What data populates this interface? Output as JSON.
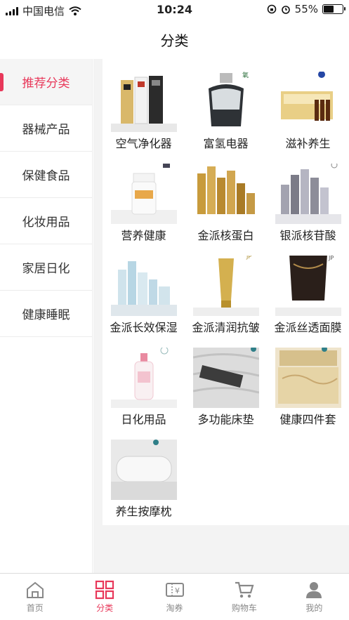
{
  "status": {
    "carrier": "中国电信",
    "time": "10:24",
    "battery": "55%"
  },
  "header": {
    "title": "分类"
  },
  "sidebar": {
    "items": [
      {
        "label": "推荐分类",
        "active": true
      },
      {
        "label": "器械产品"
      },
      {
        "label": "保健食品"
      },
      {
        "label": "化妆用品"
      },
      {
        "label": "家居日化"
      },
      {
        "label": "健康睡眠"
      }
    ]
  },
  "products": [
    {
      "label": "空气净化器",
      "icon": "air-purifier"
    },
    {
      "label": "富氢电器",
      "icon": "hydrogen-appliance"
    },
    {
      "label": "滋补养生",
      "icon": "tonic-box"
    },
    {
      "label": "营养健康",
      "icon": "nutrition-bottle"
    },
    {
      "label": "金派核蛋白",
      "icon": "gold-bottles"
    },
    {
      "label": "银派核苷酸",
      "icon": "silver-bottles"
    },
    {
      "label": "金派长效保湿",
      "icon": "moisture-set"
    },
    {
      "label": "金派清润抗皱",
      "icon": "gold-tube"
    },
    {
      "label": "金派丝透面膜",
      "icon": "mask-pack"
    },
    {
      "label": "日化用品",
      "icon": "pink-pump-bottle"
    },
    {
      "label": "多功能床垫",
      "icon": "mattress"
    },
    {
      "label": "健康四件套",
      "icon": "bedding-set"
    },
    {
      "label": "养生按摩枕",
      "icon": "massage-pillow"
    }
  ],
  "tabbar": {
    "tabs": [
      {
        "label": "首页",
        "icon": "home-icon"
      },
      {
        "label": "分类",
        "icon": "grid-icon",
        "active": true
      },
      {
        "label": "淘券",
        "icon": "coupon-icon"
      },
      {
        "label": "购物车",
        "icon": "cart-icon"
      },
      {
        "label": "我的",
        "icon": "user-icon"
      }
    ]
  },
  "colors": {
    "accent": "#e8385a",
    "inactive": "#888888"
  }
}
